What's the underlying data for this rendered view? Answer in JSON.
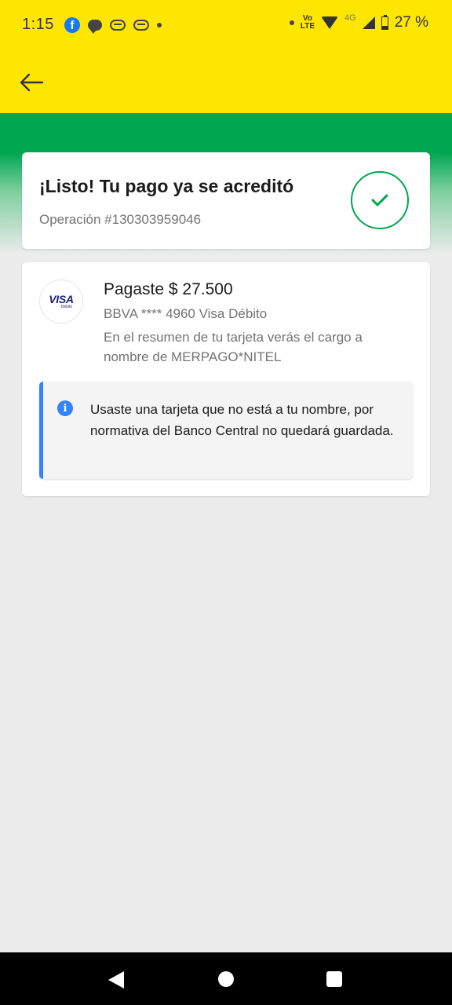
{
  "status_bar": {
    "time": "1:15",
    "battery_text": "27 %",
    "network_label": "4G",
    "volte_label_top": "Vo",
    "volte_label_bottom": "LTE",
    "battery_level": 0.27,
    "icons": [
      "facebook-icon",
      "chat-icon",
      "app-icon",
      "app-icon",
      "dot",
      "dot",
      "volte-icon",
      "wifi-icon",
      "signal-icon",
      "battery-icon"
    ]
  },
  "app_bar": {
    "back_icon": "arrow-left-icon"
  },
  "success_card": {
    "title": "¡Listo! Tu pago ya se acreditó",
    "operation": "Operación #130303959046",
    "status_icon": "check-icon"
  },
  "payment_card": {
    "card_brand_logo": "VISA",
    "card_brand_sub": "Débito",
    "amount_line": "Pagaste $ 27.500",
    "card_line": "BBVA **** 4960 Visa Débito",
    "note": "En el resumen de tu tarjeta verás el cargo a nombre de MERPAGO*NITEL",
    "info": {
      "icon": "info-icon",
      "text": "Usaste una tarjeta que no está a tu nombre, por normativa del Banco Central no quedará guardada."
    }
  },
  "nav_bar": {
    "icons": [
      "back-triangle-icon",
      "home-circle-icon",
      "recents-square-icon"
    ]
  },
  "colors": {
    "header_yellow": "#ffe600",
    "success_green": "#00a650",
    "info_blue": "#3483fa",
    "background": "#ececec"
  }
}
